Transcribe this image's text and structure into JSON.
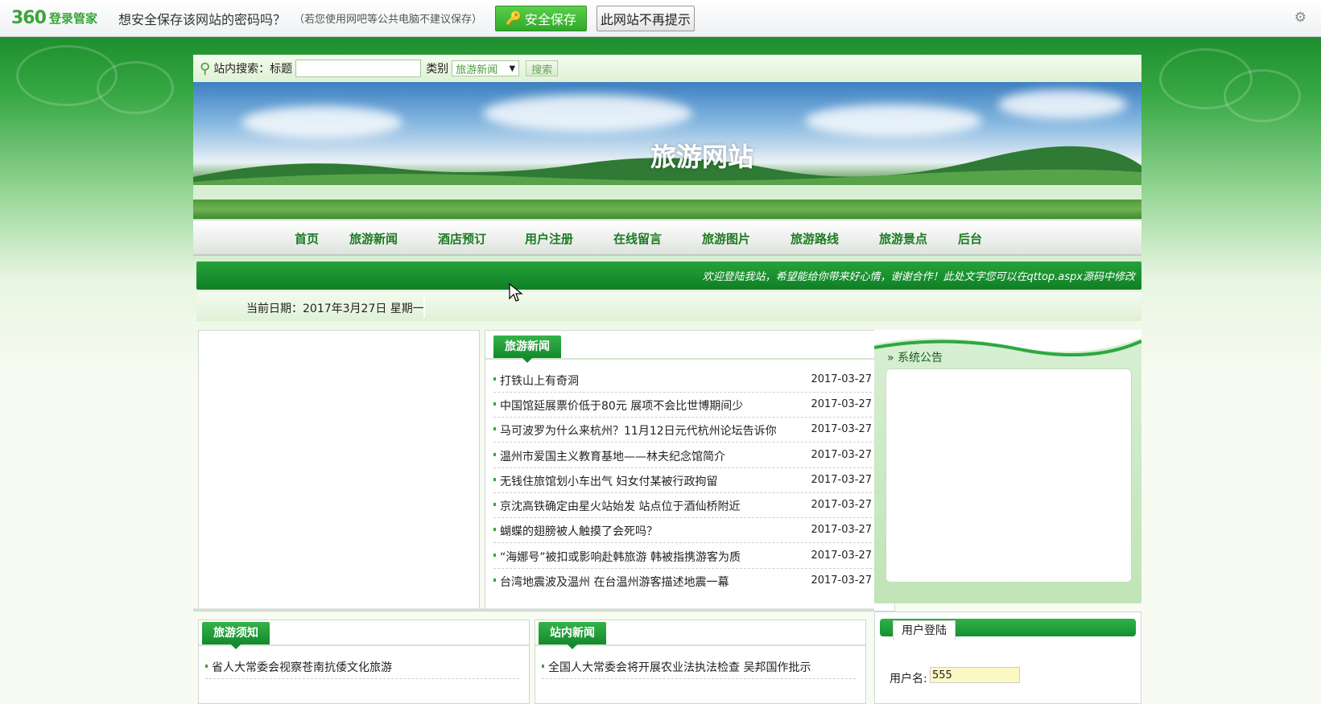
{
  "pwbar": {
    "logo": "360",
    "logo_sub": "登录管家",
    "question": "想安全保存该网站的密码吗？",
    "hint": "（若您使用网吧等公共电脑不建议保存）",
    "save_label": "安全保存",
    "nomore_label": "此网站不再提示"
  },
  "search": {
    "label": "站内搜索：标题",
    "title_value": "",
    "category_label": "类别",
    "category_selected": "旅游新闻",
    "button": "搜索"
  },
  "banner": {
    "title": "旅游网站"
  },
  "nav": [
    "首页",
    "旅游新闻",
    "酒店预订",
    "用户注册",
    "在线留言",
    "旅游图片",
    "旅游路线",
    "旅游景点",
    "后台"
  ],
  "marquee": "欢迎登陆我站，希望能给你带来好心情，谢谢合作！此处文字您可以在qttop.aspx源码中修改",
  "datebar": {
    "date": "当前日期：2017年3月27日 星期一"
  },
  "news": {
    "title": "旅游新闻",
    "items": [
      {
        "title": "打铁山上有奇洞",
        "date": "2017-03-27"
      },
      {
        "title": "中国馆延展票价低于80元 展项不会比世博期间少",
        "date": "2017-03-27"
      },
      {
        "title": "马可波罗为什么来杭州？11月12日元代杭州论坛告诉你",
        "date": "2017-03-27"
      },
      {
        "title": "温州市爱国主义教育基地——林夫纪念馆简介",
        "date": "2017-03-27"
      },
      {
        "title": "无钱住旅馆划小车出气 妇女付某被行政拘留",
        "date": "2017-03-27"
      },
      {
        "title": "京沈高铁确定由星火站始发 站点位于酒仙桥附近",
        "date": "2017-03-27"
      },
      {
        "title": "蝴蝶的翅膀被人触摸了会死吗？",
        "date": "2017-03-27"
      },
      {
        "title": "“海娜号”被扣或影响赴韩旅游 韩被指携游客为质",
        "date": "2017-03-27"
      },
      {
        "title": "台湾地震波及温州 在台温州游客描述地震一幕",
        "date": "2017-03-27"
      }
    ]
  },
  "notice": {
    "title": "系统公告"
  },
  "login": {
    "title": "用户登陆",
    "username_label": "用户名:",
    "username_value": "555"
  },
  "notes": {
    "title": "旅游须知",
    "items": [
      "省人大常委会视察苍南抗倭文化旅游"
    ]
  },
  "sitenews": {
    "title": "站内新闻",
    "items": [
      "全国人大常委会将开展农业法执法检查 吴邦国作批示"
    ]
  },
  "colors": {
    "brand_green": "#1d7a21",
    "accent": "#2fa82a",
    "nav_text": "#1d7a21"
  }
}
